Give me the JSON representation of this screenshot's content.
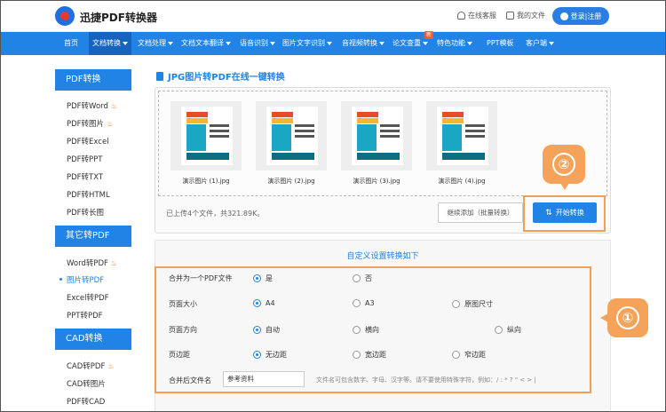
{
  "header": {
    "app_name": "迅捷PDF转换器",
    "service": "在线客服",
    "my_files": "我的文件",
    "login": "登录|注册"
  },
  "nav": {
    "items": [
      "首页",
      "文档转换",
      "文档处理",
      "文档文本翻译",
      "语音识别",
      "图片文字识别",
      "音视频转换",
      "论文查重",
      "特色功能",
      "PPT模板",
      "客户端"
    ],
    "badge": "新"
  },
  "sidebar": {
    "sections": [
      {
        "title": "PDF转换",
        "items": [
          "PDF转Word",
          "PDF转图片",
          "PDF转Excel",
          "PDF转PPT",
          "PDF转TXT",
          "PDF转HTML",
          "PDF转长图"
        ]
      },
      {
        "title": "其它转PDF",
        "items": [
          "Word转PDF",
          "图片转PDF",
          "Excel转PDF",
          "PPT转PDF"
        ]
      },
      {
        "title": "CAD转换",
        "items": [
          "CAD转PDF",
          "CAD转图片",
          "PDF转CAD"
        ]
      }
    ]
  },
  "main": {
    "title": "JPG图片转PDF在线一键转换",
    "files": [
      "演示图片 (1).jpg",
      "演示图片 (2).jpg",
      "演示图片 (3).jpg",
      "演示图片 (4).jpg"
    ],
    "upload_info": "已上传4个文件，共321.89K。",
    "continue_label": "继续添加（批量转换）",
    "start_label": "开始转换",
    "marker_1": "①",
    "marker_2": "②"
  },
  "settings": {
    "title": "自定义设置转换如下",
    "merge": {
      "label": "合并为一个PDF文件",
      "options": [
        "是",
        "否"
      ],
      "selected": "是"
    },
    "page_size": {
      "label": "页面大小",
      "options": [
        "A4",
        "A3",
        "原图尺寸"
      ],
      "selected": "A4"
    },
    "orientation": {
      "label": "页面方向",
      "options": [
        "自动",
        "横向",
        "纵向"
      ],
      "selected": "自动"
    },
    "margin": {
      "label": "页边距",
      "options": [
        "无边距",
        "宽边距",
        "窄边距"
      ],
      "selected": "无边距"
    },
    "filename": {
      "label": "合并后文件名",
      "value": "参考资料",
      "hint": "文件名可包含数字、字母、汉字等。请不要使用特殊字符，例如：/ : * ? \" < > |"
    }
  },
  "colors": {
    "primary": "#2183e6",
    "highlight": "#f5a35a"
  }
}
